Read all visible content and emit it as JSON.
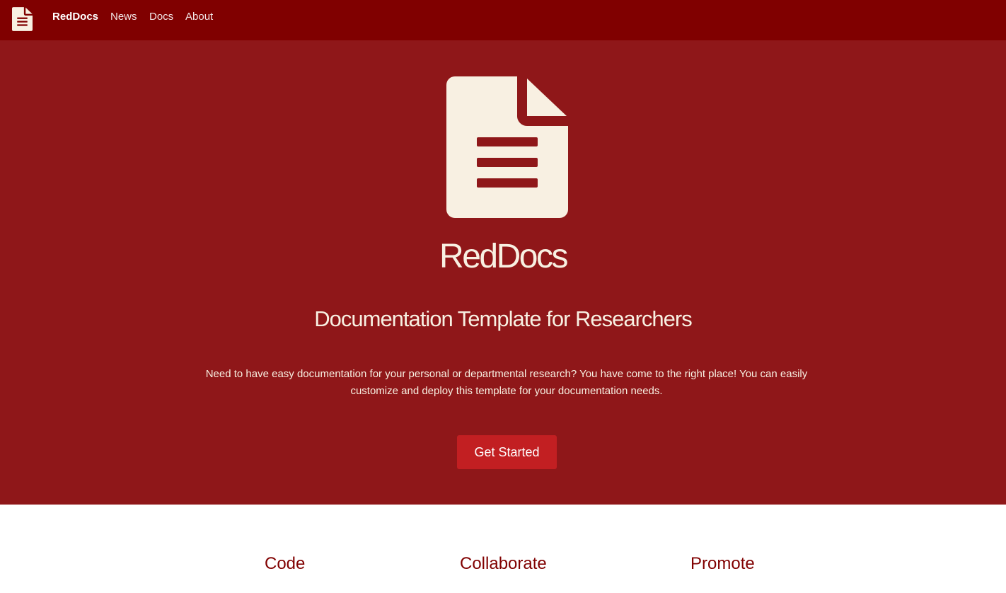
{
  "navbar": {
    "logo_icon": "file-document-icon",
    "brand": "RedDocs",
    "links": [
      "News",
      "Docs",
      "About"
    ],
    "background": "#800000"
  },
  "hero": {
    "icon": "file-document-icon",
    "title": "RedDocs",
    "subtitle": "Documentation Template for Researchers",
    "description": "Need to have easy documentation for your personal or departmental research? You have come to the right place! You can easily customize and deploy this template for your documentation needs.",
    "cta_label": "Get Started",
    "background": "#8f1719",
    "accent": "#c21f22",
    "text_color": "#f8f0e2"
  },
  "features": {
    "headings": [
      "Code",
      "Collaborate",
      "Promote"
    ],
    "heading_color": "#800000"
  }
}
